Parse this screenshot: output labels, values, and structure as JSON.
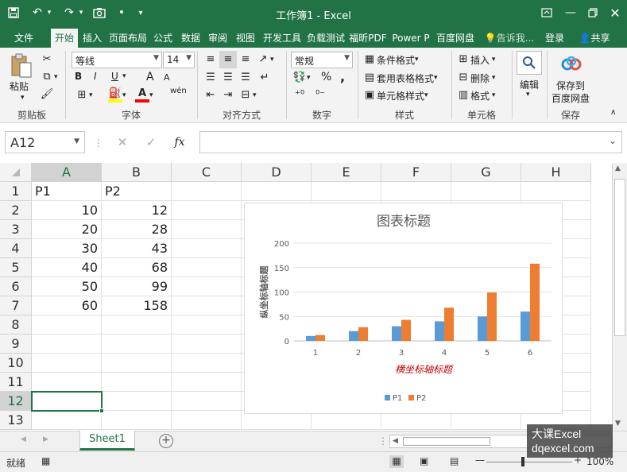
{
  "window": {
    "title": "工作簿1 - Excel",
    "quick_access": [
      "save-icon",
      "undo-icon",
      "redo-icon",
      "camera-icon",
      "dot-icon",
      "customize-icon"
    ]
  },
  "tabs": [
    {
      "label": "文件",
      "active": false
    },
    {
      "label": "开始",
      "active": true
    },
    {
      "label": "插入",
      "active": false
    },
    {
      "label": "页面布局",
      "active": false
    },
    {
      "label": "公式",
      "active": false
    },
    {
      "label": "数据",
      "active": false
    },
    {
      "label": "审阅",
      "active": false
    },
    {
      "label": "视图",
      "active": false
    },
    {
      "label": "开发工具",
      "active": false
    },
    {
      "label": "负载测试",
      "active": false
    },
    {
      "label": "福昕PDF",
      "active": false
    },
    {
      "label": "Power P",
      "active": false
    },
    {
      "label": "百度网盘",
      "active": false
    }
  ],
  "tellme": "告诉我...",
  "login": "登录",
  "share": "共享",
  "ribbon": {
    "clipboard": {
      "label": "剪贴板",
      "paste": "粘贴"
    },
    "font": {
      "label": "字体",
      "name": "等线",
      "size": "14",
      "bold": "B",
      "italic": "I",
      "underline": "U",
      "grow": "A",
      "shrink": "A",
      "phonetic": "wén"
    },
    "alignment": {
      "label": "对齐方式"
    },
    "number": {
      "label": "数字",
      "format": "常规",
      "percent": "%",
      "comma": ","
    },
    "styles": {
      "label": "样式",
      "conditional": "条件格式",
      "table": "套用表格格式",
      "cell": "单元格样式"
    },
    "cells": {
      "label": "单元格",
      "insert": "插入",
      "delete": "删除",
      "format": "格式"
    },
    "editing": {
      "label": "编辑"
    },
    "save": {
      "label": "保存",
      "button_line1": "保存到",
      "button_line2": "百度网盘"
    }
  },
  "formula_bar": {
    "namebox": "A12",
    "fx": "fx",
    "value": ""
  },
  "columns": [
    "A",
    "B",
    "C",
    "D",
    "E",
    "F",
    "G",
    "H"
  ],
  "rows": [
    "1",
    "2",
    "3",
    "4",
    "5",
    "6",
    "7",
    "8",
    "9",
    "10",
    "11",
    "12",
    "13"
  ],
  "cells": [
    [
      "P1",
      "P2"
    ],
    [
      "10",
      "12"
    ],
    [
      "20",
      "28"
    ],
    [
      "30",
      "43"
    ],
    [
      "40",
      "68"
    ],
    [
      "50",
      "99"
    ],
    [
      "60",
      "158"
    ]
  ],
  "active_cell": "A12",
  "chart_data": {
    "type": "bar",
    "title": "图表标题",
    "xlabel": "横坐标轴标题",
    "ylabel": "纵坐标轴标题",
    "categories": [
      "1",
      "2",
      "3",
      "4",
      "5",
      "6"
    ],
    "series": [
      {
        "name": "P1",
        "values": [
          10,
          20,
          30,
          40,
          50,
          60
        ],
        "color": "#5b9bd5"
      },
      {
        "name": "P2",
        "values": [
          12,
          28,
          43,
          68,
          99,
          158
        ],
        "color": "#ed7d31"
      }
    ],
    "ylim": [
      0,
      200
    ],
    "yticks": [
      "0",
      "50",
      "100",
      "150",
      "200"
    ],
    "grid": true,
    "legend": "bottom",
    "xlabel_color": "#c00000"
  },
  "sheet_tab": "Sheet1",
  "status": {
    "ready": "就绪",
    "zoom": "100%"
  },
  "watermark": {
    "line1": "大课Excel",
    "line2": "dqexcel.com"
  }
}
